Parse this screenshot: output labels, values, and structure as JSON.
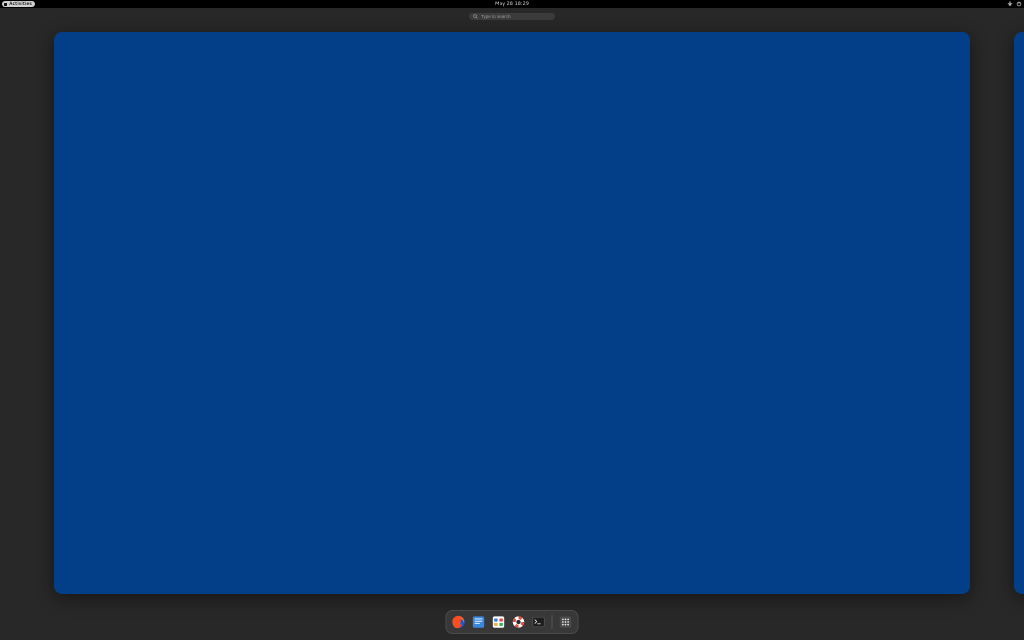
{
  "topbar": {
    "activities_label": "Activities",
    "datetime": "May 28  18:29"
  },
  "search": {
    "placeholder": "Type to search"
  },
  "workspaces": {
    "wallpaper_color": "#023f88"
  },
  "dash": {
    "items": [
      {
        "name": "firefox-icon"
      },
      {
        "name": "text-editor-icon"
      },
      {
        "name": "software-icon"
      },
      {
        "name": "help-icon"
      },
      {
        "name": "terminal-icon"
      }
    ],
    "show_apps_name": "show-applications-icon"
  }
}
